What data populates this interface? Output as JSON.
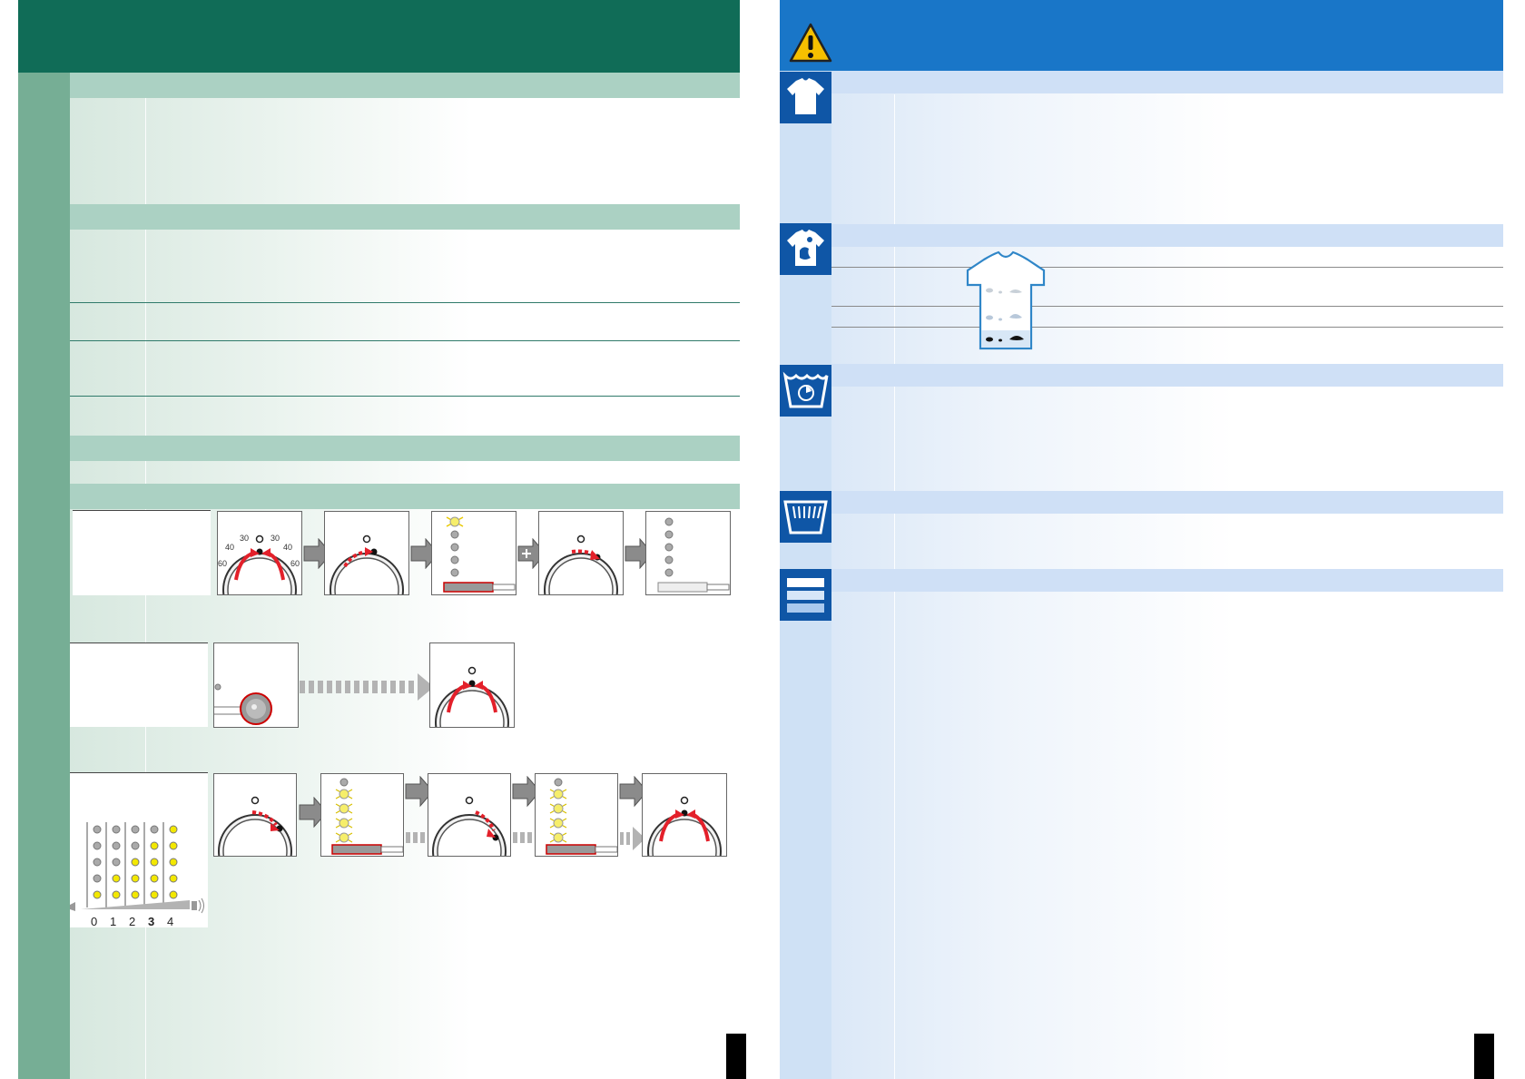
{
  "left_page": {
    "accent_colors": {
      "header": "#106c57",
      "sidebar": "#76ae95",
      "section_strip": "#abd1c3"
    },
    "dial_ticks": [
      "30",
      "30",
      "40",
      "40",
      "60",
      "60"
    ],
    "volume_scale": {
      "labels": [
        "0",
        "1",
        "2",
        "3",
        "4"
      ],
      "selected": "3"
    }
  },
  "right_page": {
    "accent_colors": {
      "header": "#1976c8",
      "sidebar": "#cfe1f5",
      "icon_bg": "#0f56a6"
    },
    "icons": [
      "warning-icon",
      "tshirt-icon",
      "stained-tshirt-icon",
      "wash-timer-icon",
      "wash-tub-icon",
      "menu-lines-icon"
    ]
  }
}
